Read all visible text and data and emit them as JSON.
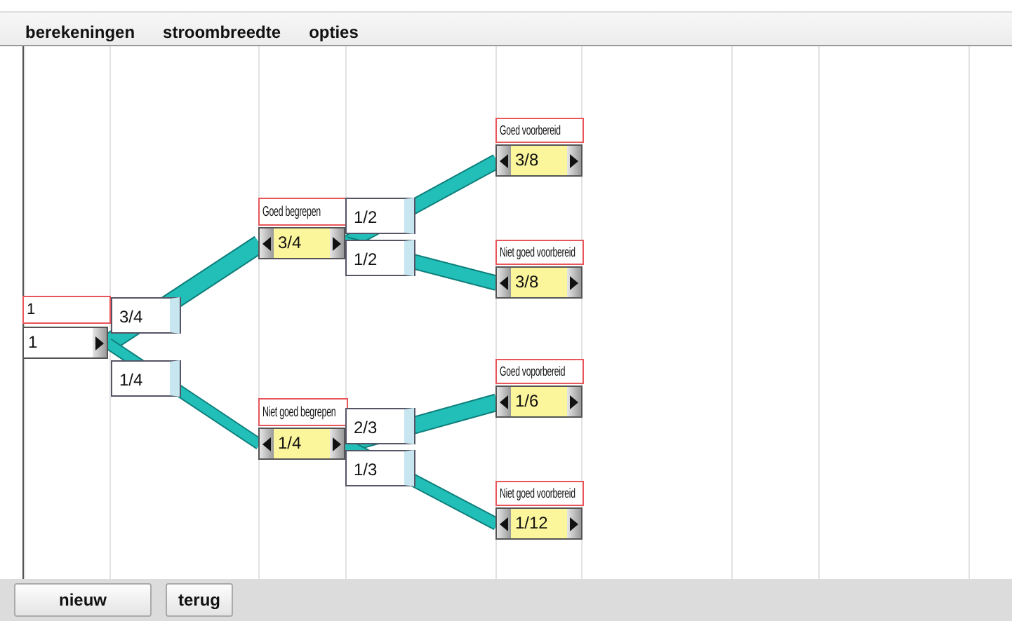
{
  "menu": [
    "berekeningen",
    "stroombreedte",
    "opties"
  ],
  "tree": {
    "label": "1",
    "value": "1",
    "children": [
      {
        "branch": "3/4",
        "label": "Goed begrepen",
        "value": "3/4",
        "children": [
          {
            "branch": "1/2",
            "label": "Goed voorbereid",
            "value": "3/8"
          },
          {
            "branch": "1/2",
            "label": "Niet goed voorbereid",
            "value": "3/8"
          }
        ]
      },
      {
        "branch": "1/4",
        "label": "Niet goed begrepen",
        "value": "1/4",
        "children": [
          {
            "branch": "2/3",
            "label": "Goed voporbereid",
            "value": "1/6"
          },
          {
            "branch": "1/3",
            "label": "Niet goed voorbereid",
            "value": "1/12"
          }
        ]
      }
    ]
  },
  "buttons": [
    "nieuw",
    "terug"
  ]
}
